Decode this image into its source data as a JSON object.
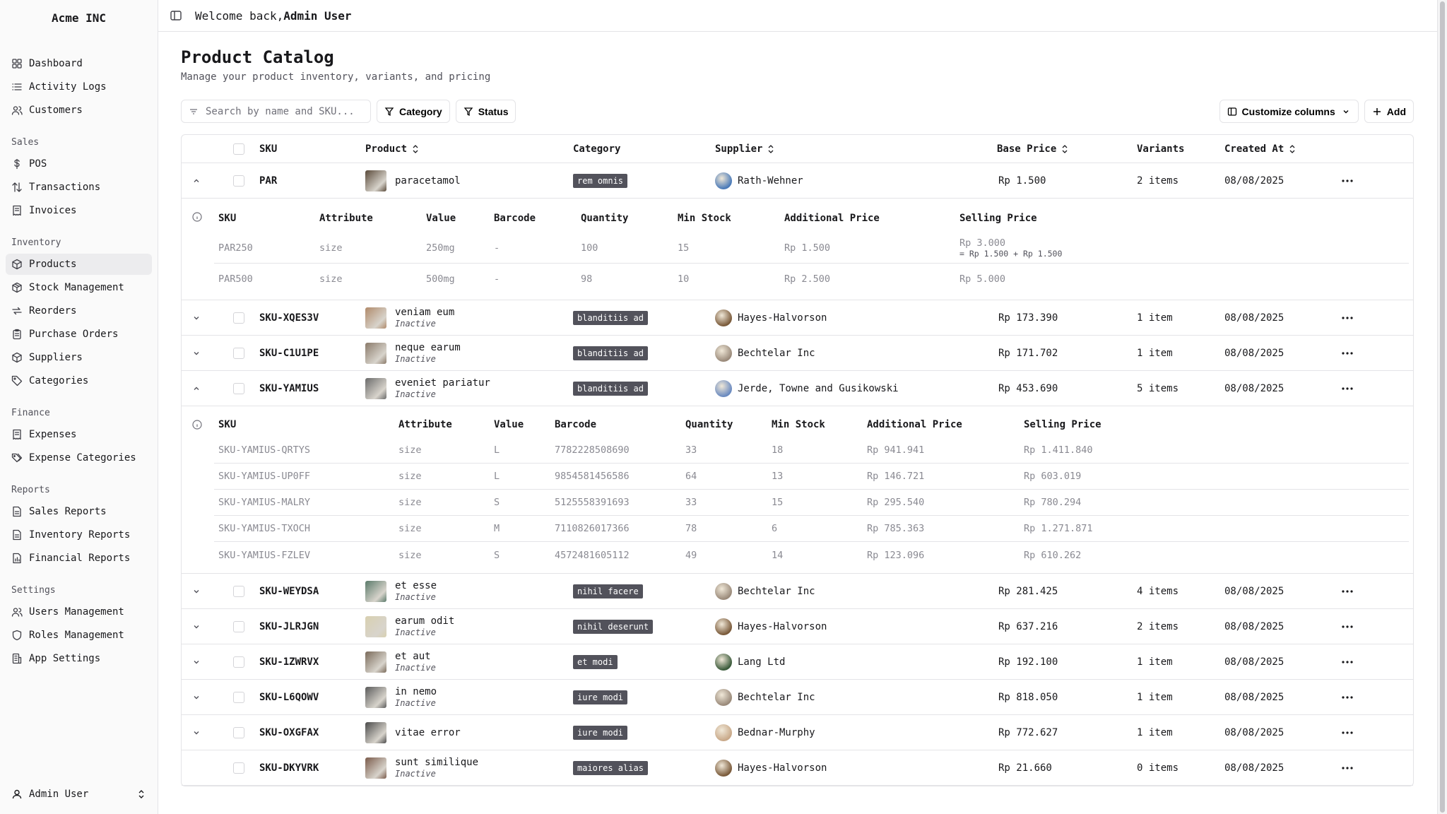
{
  "app": {
    "brand": "Acme INC"
  },
  "sidebar": {
    "top_items": [
      {
        "label": "Dashboard",
        "icon": "dashboard-icon"
      },
      {
        "label": "Activity Logs",
        "icon": "list-icon"
      },
      {
        "label": "Customers",
        "icon": "users-icon"
      }
    ],
    "groups": [
      {
        "title": "Sales",
        "items": [
          {
            "label": "POS",
            "icon": "dollar-icon"
          },
          {
            "label": "Transactions",
            "icon": "arrows-icon"
          },
          {
            "label": "Invoices",
            "icon": "receipt-icon"
          }
        ]
      },
      {
        "title": "Inventory",
        "items": [
          {
            "label": "Products",
            "icon": "package-icon",
            "active": true
          },
          {
            "label": "Stock Management",
            "icon": "box-icon"
          },
          {
            "label": "Reorders",
            "icon": "repeat-icon"
          },
          {
            "label": "Purchase Orders",
            "icon": "clipboard-icon"
          },
          {
            "label": "Suppliers",
            "icon": "package-icon"
          },
          {
            "label": "Categories",
            "icon": "tag-icon"
          }
        ]
      },
      {
        "title": "Finance",
        "items": [
          {
            "label": "Expenses",
            "icon": "receipt-icon"
          },
          {
            "label": "Expense Categories",
            "icon": "tags-icon"
          }
        ]
      },
      {
        "title": "Reports",
        "items": [
          {
            "label": "Sales Reports",
            "icon": "file-icon"
          },
          {
            "label": "Inventory Reports",
            "icon": "file-icon"
          },
          {
            "label": "Financial Reports",
            "icon": "file-chart-icon"
          }
        ]
      },
      {
        "title": "Settings",
        "items": [
          {
            "label": "Users Management",
            "icon": "users-icon"
          },
          {
            "label": "Roles Management",
            "icon": "shield-icon"
          },
          {
            "label": "App Settings",
            "icon": "building-icon"
          }
        ]
      }
    ],
    "footer_user": "Admin User"
  },
  "header": {
    "welcome_prefix": "Welcome back,",
    "user": "Admin User"
  },
  "page": {
    "title": "Product Catalog",
    "subtitle": "Manage your product inventory, variants, and pricing"
  },
  "toolbar": {
    "search_placeholder": "Search by name and SKU...",
    "category_label": "Category",
    "status_label": "Status",
    "customize_label": "Customize columns",
    "add_label": "Add"
  },
  "table": {
    "columns": {
      "sku": "SKU",
      "product": "Product",
      "category": "Category",
      "supplier": "Supplier",
      "base_price": "Base Price",
      "variants": "Variants",
      "created_at": "Created At"
    },
    "variant_columns": {
      "sku": "SKU",
      "attribute": "Attribute",
      "value": "Value",
      "barcode": "Barcode",
      "quantity": "Quantity",
      "min_stock": "Min Stock",
      "additional_price": "Additional Price",
      "selling_price": "Selling Price"
    },
    "rows": [
      {
        "sku": "PAR",
        "name": "paracetamol",
        "status": "",
        "category": "rem omnis",
        "supplier": "Rath-Wehner",
        "price": "Rp 1.500",
        "variants": "2 items",
        "created": "08/08/2025",
        "expanded": true,
        "thumb": "#5a4a3a",
        "avatar": "#4a7ab8",
        "variant_rows": [
          {
            "sku": "PAR250",
            "attribute": "size",
            "value": "250mg",
            "barcode": "-",
            "quantity": "100",
            "min_stock": "15",
            "additional_price": "Rp 1.500",
            "selling_price": "Rp 3.000",
            "formula": "= Rp 1.500 + Rp 1.500"
          },
          {
            "sku": "PAR500",
            "attribute": "size",
            "value": "500mg",
            "barcode": "-",
            "quantity": "98",
            "min_stock": "10",
            "additional_price": "Rp 2.500",
            "selling_price": "Rp 5.000",
            "formula": ""
          }
        ]
      },
      {
        "sku": "SKU-XQES3V",
        "name": "veniam eum",
        "status": "Inactive",
        "category": "blanditiis ad",
        "supplier": "Hayes-Halvorson",
        "price": "Rp 173.390",
        "variants": "1 item",
        "created": "08/08/2025",
        "expanded": false,
        "thumb": "#b08a6a",
        "avatar": "#7a5a3a"
      },
      {
        "sku": "SKU-C1U1PE",
        "name": "neque earum",
        "status": "Inactive",
        "category": "blanditiis ad",
        "supplier": "Bechtelar Inc",
        "price": "Rp 171.702",
        "variants": "1 item",
        "created": "08/08/2025",
        "expanded": false,
        "thumb": "#8a7a6a",
        "avatar": "#9a8a7a"
      },
      {
        "sku": "SKU-YAMIUS",
        "name": "eveniet pariatur",
        "status": "Inactive",
        "category": "blanditiis ad",
        "supplier": "Jerde, Towne and Gusikowski",
        "price": "Rp 453.690",
        "variants": "5 items",
        "created": "08/08/2025",
        "expanded": true,
        "thumb": "#6a6a6a",
        "avatar": "#6a8ac0",
        "variant_rows": [
          {
            "sku": "SKU-YAMIUS-QRTYS",
            "attribute": "size",
            "value": "L",
            "barcode": "7782228508690",
            "quantity": "33",
            "min_stock": "18",
            "additional_price": "Rp 941.941",
            "selling_price": "Rp 1.411.840",
            "formula": ""
          },
          {
            "sku": "SKU-YAMIUS-UP0FF",
            "attribute": "size",
            "value": "L",
            "barcode": "9854581456586",
            "quantity": "64",
            "min_stock": "13",
            "additional_price": "Rp 146.721",
            "selling_price": "Rp 603.019",
            "formula": ""
          },
          {
            "sku": "SKU-YAMIUS-MALRY",
            "attribute": "size",
            "value": "S",
            "barcode": "5125558391693",
            "quantity": "33",
            "min_stock": "15",
            "additional_price": "Rp 295.540",
            "selling_price": "Rp 780.294",
            "formula": ""
          },
          {
            "sku": "SKU-YAMIUS-TXOCH",
            "attribute": "size",
            "value": "M",
            "barcode": "7110826017366",
            "quantity": "78",
            "min_stock": "6",
            "additional_price": "Rp 785.363",
            "selling_price": "Rp 1.271.871",
            "formula": ""
          },
          {
            "sku": "SKU-YAMIUS-FZLEV",
            "attribute": "size",
            "value": "S",
            "barcode": "4572481605112",
            "quantity": "49",
            "min_stock": "14",
            "additional_price": "Rp 123.096",
            "selling_price": "Rp 610.262",
            "formula": ""
          }
        ]
      },
      {
        "sku": "SKU-WEYDSA",
        "name": "et esse",
        "status": "Inactive",
        "category": "nihil facere",
        "supplier": "Bechtelar Inc",
        "price": "Rp 281.425",
        "variants": "4 items",
        "created": "08/08/2025",
        "expanded": false,
        "thumb": "#5a7a6a",
        "avatar": "#9a8a7a"
      },
      {
        "sku": "SKU-JLRJGN",
        "name": "earum odit",
        "status": "Inactive",
        "category": "nihil deserunt",
        "supplier": "Hayes-Halvorson",
        "price": "Rp 637.216",
        "variants": "2 items",
        "created": "08/08/2025",
        "expanded": false,
        "thumb": "#d8d0b0",
        "avatar": "#7a5a3a"
      },
      {
        "sku": "SKU-1ZWRVX",
        "name": "et aut",
        "status": "Inactive",
        "category": "et modi",
        "supplier": "Lang Ltd",
        "price": "Rp 192.100",
        "variants": "1 item",
        "created": "08/08/2025",
        "expanded": false,
        "thumb": "#7a6a5a",
        "avatar": "#3a5a3a"
      },
      {
        "sku": "SKU-L6QOWV",
        "name": "in nemo",
        "status": "Inactive",
        "category": "iure modi",
        "supplier": "Bechtelar Inc",
        "price": "Rp 818.050",
        "variants": "1 item",
        "created": "08/08/2025",
        "expanded": false,
        "thumb": "#5a5a5a",
        "avatar": "#9a8a7a"
      },
      {
        "sku": "SKU-OXGFAX",
        "name": "vitae error",
        "status": "",
        "category": "iure modi",
        "supplier": "Bednar-Murphy",
        "price": "Rp 772.627",
        "variants": "1 item",
        "created": "08/08/2025",
        "expanded": false,
        "thumb": "#4a4a4a",
        "avatar": "#c8a888"
      },
      {
        "sku": "SKU-DKYVRK",
        "name": "sunt similique",
        "status": "Inactive",
        "category": "maiores alias",
        "supplier": "Hayes-Halvorson",
        "price": "Rp 21.660",
        "variants": "0 items",
        "created": "08/08/2025",
        "expanded": null,
        "thumb": "#7a5a4a",
        "avatar": "#7a5a3a"
      }
    ]
  }
}
